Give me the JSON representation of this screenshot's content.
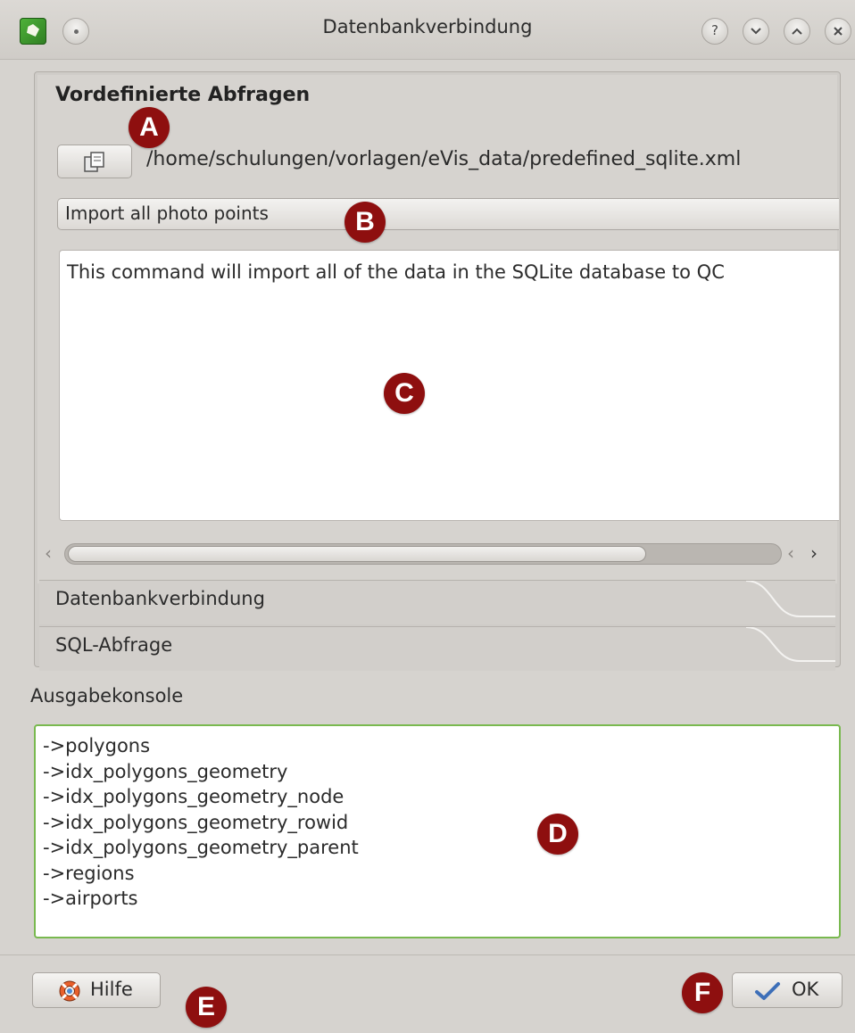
{
  "window": {
    "title": "Datenbankverbindung",
    "buttons": [
      "help",
      "minimize",
      "maximize",
      "close"
    ]
  },
  "predefined": {
    "group_title": "Vordefinierte Abfragen",
    "file_path": "/home/schulungen/vorlagen/eVis_data/predefined_sqlite.xml",
    "query_selected": "Import all photo points",
    "description": "This command will import all of the data in the SQLite database to QC"
  },
  "toolbox_tabs": [
    {
      "label": "Datenbankverbindung"
    },
    {
      "label": "SQL-Abfrage"
    }
  ],
  "console": {
    "label": "Ausgabekonsole",
    "lines": [
      "->polygons",
      "->idx_polygons_geometry",
      "->idx_polygons_geometry_node",
      "->idx_polygons_geometry_rowid",
      "->idx_polygons_geometry_parent",
      "->regions",
      "->airports"
    ]
  },
  "footer": {
    "help_label": "Hilfe",
    "ok_label": "OK"
  },
  "callouts": {
    "a": "A",
    "b": "B",
    "c": "C",
    "d": "D",
    "e": "E",
    "f": "F"
  },
  "colors": {
    "window_bg": "#d6d3cf",
    "console_border": "#79b94f",
    "callout_bg": "#8e0f0f"
  }
}
